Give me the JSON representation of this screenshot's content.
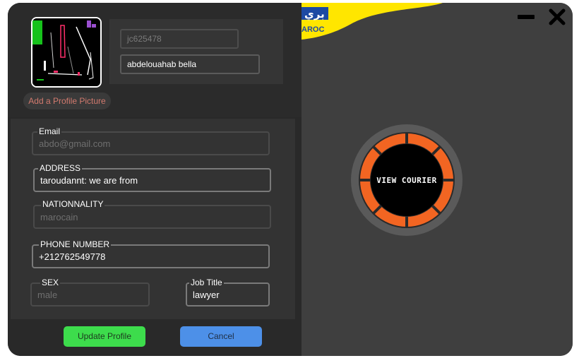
{
  "profile": {
    "add_picture_label": "Add a Profile Picture",
    "id_value": "jc625478",
    "name_value": "abdelouahab bella"
  },
  "form": {
    "email": {
      "label": "Email",
      "value": "abdo@gmail.com"
    },
    "address": {
      "label": "ADDRESS",
      "value": "taroudannt: we are from"
    },
    "nationality": {
      "label": "NATIONNALITY",
      "value": "marocain"
    },
    "phone": {
      "label": "PHONE NUMBER",
      "value": "+212762549778"
    },
    "sex": {
      "label": "SEX",
      "value": "male"
    },
    "job": {
      "label": "Job Title",
      "value": "lawyer"
    }
  },
  "buttons": {
    "update": "Update Profile",
    "cancel": "Cancel"
  },
  "brand": {
    "logo_text_top": "بري",
    "logo_text_bottom": "AROC"
  },
  "courier": {
    "label": "VIEW COURIER"
  },
  "colors": {
    "accent_orange": "#f26522",
    "update_green": "#3ddc4c",
    "cancel_blue": "#4d90e8",
    "logo_yellow": "#ffe600"
  }
}
